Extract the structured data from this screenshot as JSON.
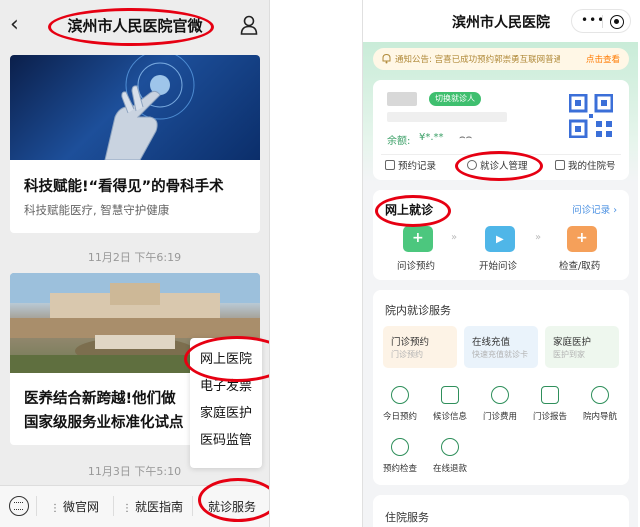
{
  "left_phone": {
    "header": {
      "back_icon": "chevron-left-icon",
      "title": "滨州市人民医院官微",
      "profile_icon": "person-icon"
    },
    "articles": [
      {
        "title": "科技赋能!“看得见”的骨科手术",
        "subtitle": "科技赋能医疗, 智慧守护健康"
      },
      {
        "title_line1": "医养结合新跨越!他们做",
        "title_line2": "国家级服务业标准化试点"
      }
    ],
    "timestamps": [
      "11月2日 下午6:19",
      "11月3日 下午5:10"
    ],
    "popup_menu": [
      "网上医院",
      "电子发票",
      "家庭医护",
      "医码监管"
    ],
    "bottom_tabs": [
      "微官网",
      "就医指南",
      "就诊服务"
    ]
  },
  "right_phone": {
    "header": {
      "title": "滨州市人民医院"
    },
    "notice": {
      "text": "通知公告: 宫喜已成功预约郭崇勇互联网普通号",
      "link": "点击查看"
    },
    "patient_card": {
      "switch_tag": "切换就诊人",
      "balance_label": "余额:",
      "balance_value": "¥*.**",
      "eye_icon": "eye-closed-icon",
      "nav": [
        "预约记录",
        "就诊人管理",
        "我的住院号"
      ]
    },
    "online_section": {
      "title": "网上就诊",
      "record_link": "问诊记录 ›",
      "steps": [
        {
          "label": "问诊预约",
          "color": "#4cc77e"
        },
        {
          "label": "开始问诊",
          "color": "#4fb6e8"
        },
        {
          "label": "检查/取药",
          "color": "#f5a05a"
        }
      ],
      "arrow": "»"
    },
    "inhospital_section": {
      "title": "院内就诊服务",
      "tiles": [
        {
          "title": "门诊预约",
          "sub": "门诊预约",
          "bg": "#fdf3e6"
        },
        {
          "title": "在线充值",
          "sub": "快速充值就诊卡",
          "bg": "#eaf3fb"
        },
        {
          "title": "家庭医护",
          "sub": "医护到家",
          "bg": "#eef7ee"
        }
      ],
      "services_row1": [
        "今日预约",
        "候诊信息",
        "门诊费用",
        "门诊报告",
        "院内导航"
      ],
      "services_row2": [
        "预约检查",
        "在线退款"
      ]
    },
    "bottom_section": {
      "title": "住院服务"
    }
  },
  "annotation_color": "#e60012"
}
